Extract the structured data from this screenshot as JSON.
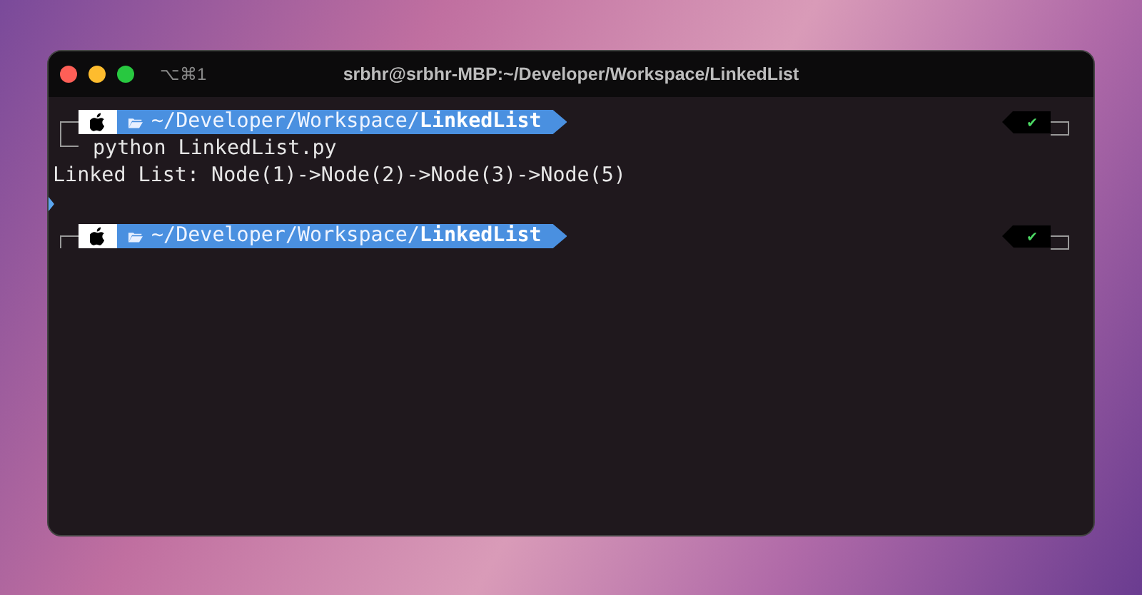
{
  "window": {
    "shortcut": "⌥⌘1",
    "title": "srbhr@srbhr-MBP:~/Developer/Workspace/LinkedList"
  },
  "lines": [
    {
      "kind": "prompt",
      "path": "~/Developer/Workspace/**LinkedList**",
      "status": "✔",
      "has_command": true
    },
    {
      "kind": "command",
      "text": "python LinkedList.py"
    },
    {
      "kind": "output",
      "text": "Linked List: Node(1)->Node(2)->Node(3)->Node(5)"
    },
    {
      "kind": "marker"
    },
    {
      "kind": "prompt",
      "path": "~/Developer/Workspace/**LinkedList**",
      "status": "✔",
      "has_command": false
    }
  ]
}
